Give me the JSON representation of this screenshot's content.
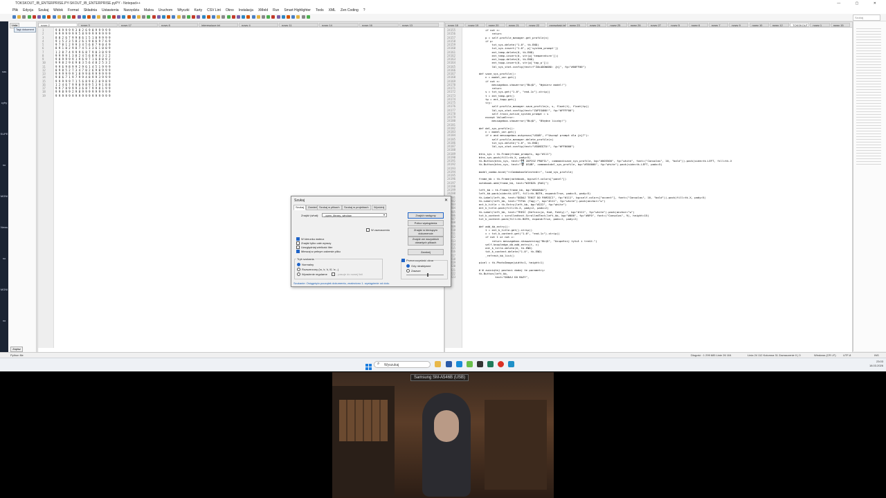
{
  "window": {
    "title": "TOKSKOUT_IB_ENTERPRISE.PY-SKOUT_IB_ENTERPRISE.pyPY - Notepad++",
    "controls": "— ▢ ✕"
  },
  "menu": [
    "Plik",
    "Edycja",
    "Szukaj",
    "Widok",
    "Format",
    "Składnia",
    "Ustawienia",
    "Narzędzia",
    "Makra",
    "Uruchom",
    "Wtyczki",
    "Karty",
    "CSV Lint",
    "Okno",
    "Instalacja",
    "XMeld",
    "Run",
    "Smart Highlighter",
    "Tools",
    "XML",
    "Zen Coding",
    "?"
  ],
  "search_placeholder": "Szukaj",
  "left_panel": {
    "tab": "Lista",
    "item": "Tagi dokument",
    "bottom_button": "Zapisz",
    "desk_labels": [
      "nas",
      "cyfry",
      "SUPE",
      "no",
      "MONI",
      "News",
      "no",
      "MONI",
      "no"
    ]
  },
  "left_pane": {
    "tabs": [
      "nowy 2",
      "nowy 3",
      "nowy 17",
      "nowy 8",
      "interesujące.txt",
      "nowy 4",
      "nowy 11",
      "nowy 14",
      "nowy 16",
      "nowy 13"
    ],
    "line_numbers": [
      "1",
      "2",
      "3",
      "4",
      "5",
      "6",
      "7",
      "8",
      "9",
      "10",
      "11",
      "12",
      "13",
      "14",
      "15",
      "16",
      "17",
      "18",
      "19"
    ],
    "lines": [
      "9 8 9 9 9 9 3 8 2 6 9 0 9 9 9 9 9",
      "9 9 9 9 9 9 9 5 8 9 9 9 9 9 9 9 9",
      "8 0 2 6 7 9 9 8 6 1 5 1 0 9 9 9 9",
      "9 1 5 2 3 5 8 2 6 1 9 0 6 9 7 6 9",
      "9 7 8 1 2 9 9 3 4 5 6 8 7 9 0 4 9",
      "8 9 1 0 2 9 8 7 4 5 3 3 6 1 0 0 9",
      "1 2 8 7 4 9 9 9 6 8 7 9 0 3 0 9 9",
      "9 9 9 9 1 3 8 2 4 5 6 8 9 4 3 2 2",
      "9 0 9 9 9 9 1 9 6 9 7 1 6 8 0 9 2",
      "9 9 8 2 9 6 9 0 3 5 6 4 8 2 5 3 2",
      "9 9 6 9 8 9 9 2 9 6 1 4 5 1 9 9 9",
      "0 9 8 5 2 7 3 4 7 0 2 6 9 0 9 9 9",
      "9 9 9 9 9 9 1 8 9 9 8 9 9 9 9 9 9",
      "9 8 6 7 1 9 7 9 9 4 8 9 9 3 9 9 9",
      "9 9 9 9 9 7 1 5 6 8 9 6 2 0 9 8 9",
      "1 2 4 6 7 9 9 0 9 8 9 5 3 9 1 8 8",
      "9 9 7 8 9 9 9 3 6 8 7 9 9 8 1 9 9",
      "9 9 8 9 9 2 9 8 9 9 9 9 9 9 9 9 9",
      "9 9 9 9 9 9 9 9 9 9 9 9 9 9 9 9 9"
    ]
  },
  "right_pane": {
    "tabs": [
      "nowy 18",
      "nowy 19",
      "nowy 20",
      "nowy 21",
      "nowy 22",
      "przyszłość.txt",
      "nowy 23",
      "nowy 24",
      "nowy 25",
      "nowy 26",
      "nowy 27",
      "nowy 5",
      "nowy 6",
      "nowy 7",
      "nowy 9",
      "nowy 10",
      "nowy 12",
      "TOKSKOUT_IB_ENTERPRISE.PY",
      "nowy 1",
      "nowy 15"
    ],
    "start_line": "24155",
    "lines": [
      "            if not n:",
      "                return",
      "            p = self.profile_manager.get_profile(n)",
      "            if p:",
      "                txt_sys.delete(\"1.0\", tk.END)",
      "                txt_sys.insert(\"1.0\", p['system_prompt'])",
      "                ent_temp.delete(0, tk.END)",
      "                ent_temp.insert(0, str(p['temperature']))",
      "                ent_topp.delete(0, tk.END)",
      "                ent_topp.insert(0, str(p['top_p']))",
      "                lbl_sys_stat.config(text=f\"ZAŁADOWANO: {n}\", fg=\"#00FF00\")",
      "",
      "        def save_sys_profile():",
      "            n = model_var.get()",
      "            if not n:",
      "                messagebox.showerror(\"BŁĄD\", \"Wybierz model!\")",
      "                return",
      "            s = txt_sys.get(\"1.0\", \"end-1c\").strip()",
      "            t = ent_temp.get()",
      "            tp = ent_topp.get()",
      "            try:",
      "                self.profile_manager.save_profile(n, s, float(t), float(tp))",
      "                lbl_sys_stat.config(text=\"ZAPISANO!\", fg=\"#FFFF00\")",
      "                self.train_active_system_prompt = s",
      "            except ValueError:",
      "                messagebox.showerror(\"BŁĄD\", \"Błędne liczby!\")",
      "",
      "        def del_sys_profile():",
      "            n = model_var.get()",
      "            if n and messagebox.askyesno(\"USUŃ\", f\"Usunąć prompt dla {n}?\"):",
      "                self.profile_manager.delete_profile(n)",
      "                txt_sys.delete(\"1.0\", tk.END)",
      "                lbl_sys_stat.config(text=\"USUNIĘTO!\", fg=\"#FF0000\")",
      "",
      "        btns_sys = tk.Frame(frame_prompts, bg=\"#111\")",
      "        btns_sys.pack(fill=tk.X, pady=5)",
      "        tk.Button(btns_sys, text=\"💾 ZAPISZ PROFIL\", command=save_sys_profile, bg=\"#005500\", fg=\"white\", font=(\"Consolas\", 10, \"bold\")).pack(side=tk.LEFT, fill=tk.X",
      "        tk.Button(btns_sys, text=\"🗑 USUŃ\", command=del_sys_profile, bg=\"#550000\", fg=\"white\").pack(side=tk.LEFT, padx=5)",
      "",
      "        model_combo.bind(\"<<ComboboxSelected>>\", load_sys_profile)",
      "",
      "        frame_kb = tk.Frame(notebook, bg=self.colors[\"panel\"])",
      "        notebook.add(frame_kb, text=\"WIEDZA (RAG)\")",
      "",
      "        left_kb = tk.Frame(frame_kb, bg=\"#0A0A0A\")",
      "        left_kb.pack(side=tk.LEFT, fill=tk.BOTH, expand=True, padx=5, pady=5)",
      "        tk.Label(left_kb, text=\"DODAJ TEKST DO PAMIĘCI\", fg=\"#111\", bg=self.colors[\"accent\"], font=(\"Consolas\", 10, \"bold\")).pack(fill=tk.X, pady=5)",
      "        tk.Label(left_kb, text=\"TYTUŁ (Tag):\", bg=\"#111\", fg=\"white\").pack(anchor=\"w\")",
      "        ent_k_title = tk.Entry(left_kb, bg=\"#222\", fg=\"white\")",
      "        ent_k_title.pack(fill=tk.X, pady=2, padx=2)",
      "        tk.Label(left_kb, text=\"TREŚĆ (Definicja, Kod, Fakty):\", bg=\"#111\", fg=\"white\").pack(anchor=\"w\")",
      "        txt_k_content = scrolledtext.ScrolledText(left_kb, bg=\"#000\", fg=\"#0F0\", font=(\"Consolas\", 9), height=15)",
      "        txt_k_content.pack(fill=tk.BOTH, expand=True, padx=2, pady=2)",
      "",
      "        def add_kb_entry():",
      "            t = ent_k_title.get().strip()",
      "            c = txt_k_content.get(\"1.0\", \"end-1c\").strip()",
      "            if not t or not c:",
      "                return messagebox.showwarning(\"BŁĄD\", \"Uzupełnij tytuł i treść.\")",
      "            self.knowledge_db.add_entry(t, c)",
      "            ent_k_title.delete(0, tk.END)",
      "            txt_k_content.delete(\"1.0\", tk.END)",
      "            _refresh_kb_list()",
      "",
      "        pixel = tk.PhotoImage(width=1, height=1)",
      "",
      "        # W zwiniętej postaci dodaj te parametry:",
      "        tk.Button(left_kb,",
      "                  text=\"DODAJ DO BAZY\","
    ]
  },
  "dialog": {
    "title": "Szukaj",
    "close": "✕",
    "tabs": [
      "Szukaj",
      "Zamień",
      "Szukaj w plikach",
      "Szukaj w projektach",
      "Wyróżnij"
    ],
    "find_label": "Znajdź (what):",
    "find_value": "_open_library_window",
    "buttons": [
      "Znajdź następny",
      "Policz wystąpienia",
      "Znajdź w bieżącym dokumencie",
      "Znajdź we wszystkich otwartych plikach",
      "Zamknij"
    ],
    "in_selection": "W zaznaczeniu",
    "checkboxes": [
      {
        "label": "W kierunku wstecz",
        "checked": true
      },
      {
        "label": "Znajdź tylko całe wyrazy",
        "checked": false
      },
      {
        "label": "Uwzględniaj wielkość liter",
        "checked": false
      },
      {
        "label": "Mieszaj w pełnym zakresie pliku",
        "checked": true
      }
    ],
    "mode_title": "Tryb szukania",
    "modes": [
      {
        "label": "Normalny",
        "checked": true
      },
      {
        "label": "Rozszerzony (\\n, \\r, \\t, \\0, \\x...)",
        "checked": false
      },
      {
        "label": "Wyrażenie regularne",
        "checked": false
      }
    ],
    "dot_newline": ". pasuje do nowej linii",
    "transparency_label": "Przezroczystość okna",
    "transparency_on": true,
    "transparency_modes": [
      {
        "label": "Gdy nieaktywne",
        "checked": true
      },
      {
        "label": "Zawsze",
        "checked": false
      }
    ],
    "status": "Szukanie: Osiągnięto początek dokumentu, znaleziono 1. wystąpienie od dołu."
  },
  "statusbar": {
    "lang": "Python file",
    "length": "Długość : 1 299 685  Linie 26 104",
    "position": "Linia 24 112   Kolumna 31   Zaznaczenie 0 | 0",
    "eol": "Windows (CR LF)",
    "encoding": "UTF-8",
    "ins": "INS"
  },
  "taskbar": {
    "search": "Wyszukaj",
    "time": "23:03",
    "date": "18.03.2026"
  },
  "webcam": {
    "label": "Samsung SM-A546B (USB)"
  },
  "colors": {
    "accent": "#1e63c7",
    "active_tab": "#ffffff"
  }
}
